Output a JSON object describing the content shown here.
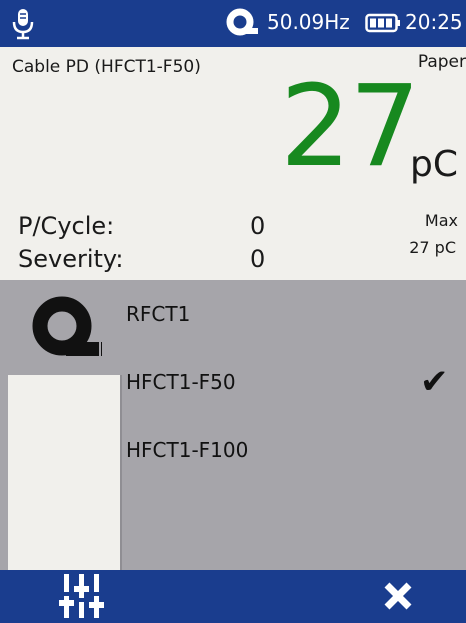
{
  "status": {
    "frequency": "50.09Hz",
    "time": "20:25",
    "icons": [
      "microphone-icon",
      "sensor-clamp-icon",
      "battery-icon"
    ]
  },
  "reading": {
    "title": "Cable PD (HFCT1-F50)",
    "mode": "Paper",
    "value": "27",
    "unit": "pC",
    "pcycle_label": "P/Cycle:",
    "pcycle_value": "0",
    "severity_label": "Severity:",
    "severity_value": "0",
    "max_label": "Max",
    "max_value": "27 pC"
  },
  "sensor_list": {
    "options": [
      "RFCT1",
      "HFCT1-F50",
      "HFCT1-F100"
    ],
    "selected": "HFCT1-F50"
  },
  "bottom": {
    "icons": [
      "sliders-icon",
      "close-icon"
    ]
  },
  "colors": {
    "bar": "#1a3d8e",
    "value_green": "#17891f",
    "panel": "#f1f0ec",
    "list_bg": "#a6a5aa"
  }
}
